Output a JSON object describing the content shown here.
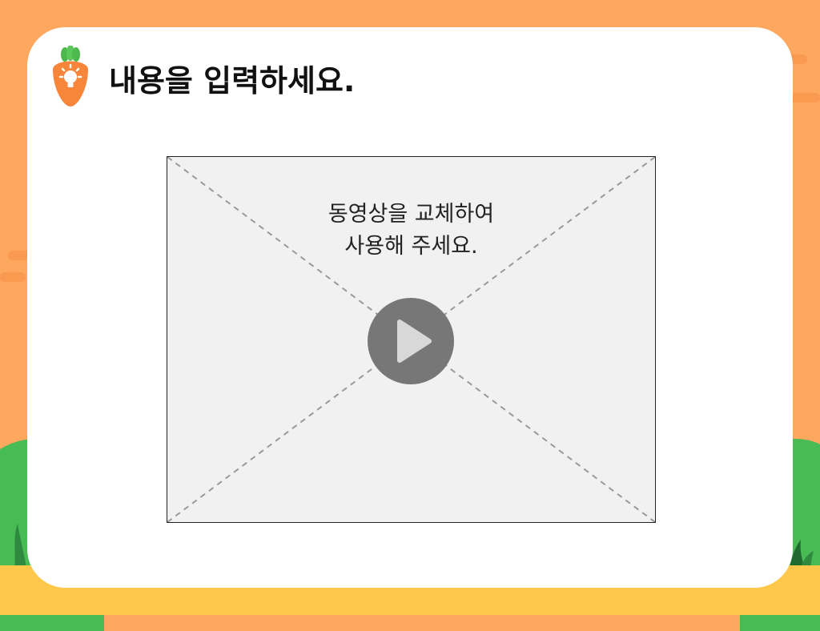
{
  "slide": {
    "title": "내용을 입력하세요.",
    "title_icon": "carrot-lightbulb-icon"
  },
  "video": {
    "placeholder_line1": "동영상을 교체하여",
    "placeholder_line2": "사용해 주세요.",
    "play_icon": "play-icon"
  },
  "colors": {
    "background": "#FEA75F",
    "card": "#FFFFFF",
    "ground": "#FFC84A",
    "hill": "#48BB55",
    "carrot": "#F7863B",
    "carrot_leaf": "#4CB84E",
    "play_button": "#777777"
  }
}
